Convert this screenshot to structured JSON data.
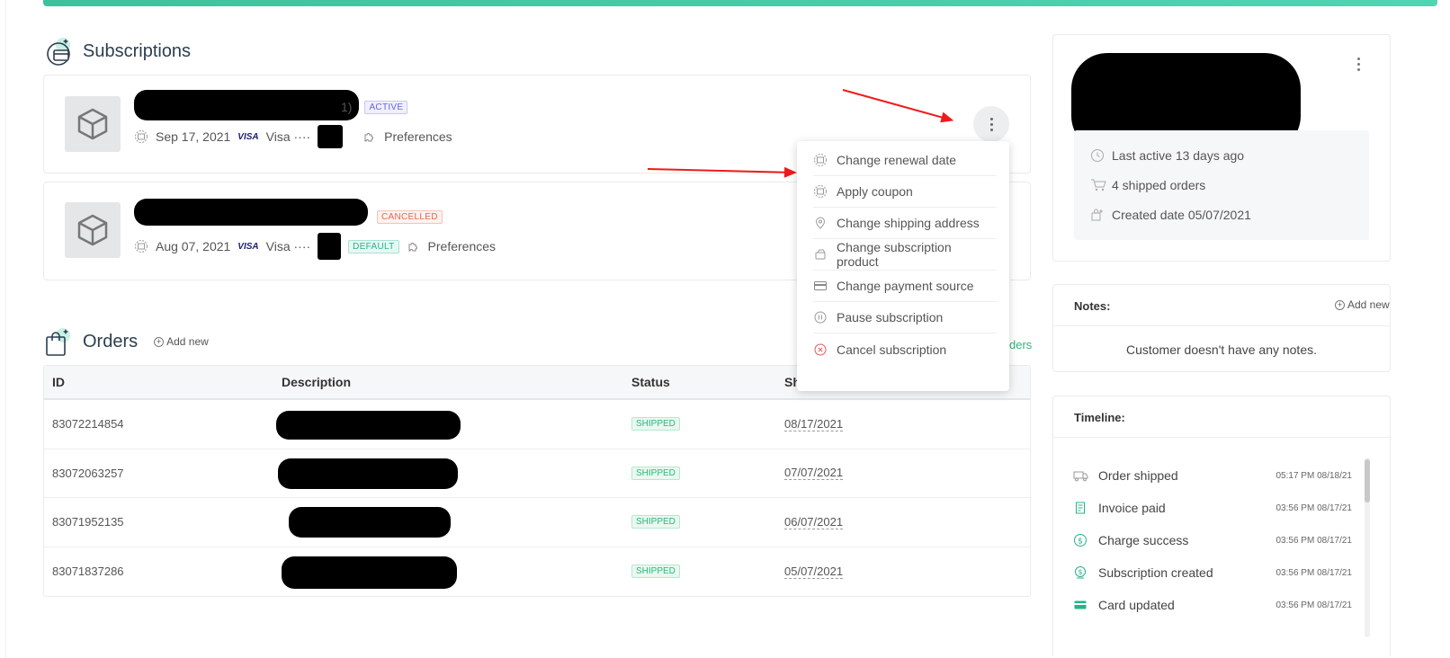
{
  "subscriptions": {
    "title": "Subscriptions",
    "items": [
      {
        "name_suffix": "1)",
        "status": "ACTIVE",
        "date": "Sep 17, 2021",
        "card_brand": "VISA",
        "card_label": "Visa ····",
        "preferences": "Preferences"
      },
      {
        "status": "CANCELLED",
        "date": "Aug 07, 2021",
        "card_brand": "VISA",
        "card_label": "Visa ····",
        "default_badge": "DEFAULT",
        "preferences": "Preferences"
      }
    ]
  },
  "menu": {
    "items": [
      {
        "label": "Change renewal date",
        "icon": "calendar-icon"
      },
      {
        "label": "Apply coupon",
        "icon": "calendar-icon"
      },
      {
        "label": "Change shipping address",
        "icon": "location-pin-icon"
      },
      {
        "label": "Change subscription product",
        "icon": "box-swap-icon"
      },
      {
        "label": "Change payment source",
        "icon": "credit-card-icon"
      },
      {
        "label": "Pause subscription",
        "icon": "pause-circle-icon"
      },
      {
        "label": "Cancel subscription",
        "icon": "cancel-circle-icon"
      }
    ]
  },
  "orders": {
    "title": "Orders",
    "add_new": "Add new",
    "view_all_fragment": "ders",
    "columns": [
      "ID",
      "Description",
      "Status",
      "Sh"
    ],
    "rows": [
      {
        "id": "83072214854",
        "status": "SHIPPED",
        "date": "08/17/2021"
      },
      {
        "id": "83072063257",
        "status": "SHIPPED",
        "date": "07/07/2021"
      },
      {
        "id": "83071952135",
        "status": "SHIPPED",
        "date": "06/07/2021"
      },
      {
        "id": "83071837286",
        "status": "SHIPPED",
        "date": "05/07/2021"
      }
    ]
  },
  "customer": {
    "last_active": "Last active 13 days ago",
    "shipped_orders": "4 shipped orders",
    "created_date": "Created date 05/07/2021"
  },
  "notes": {
    "title": "Notes:",
    "add_new": "Add new",
    "empty_text": "Customer doesn't have any notes."
  },
  "timeline": {
    "title": "Timeline:",
    "items": [
      {
        "label": "Order shipped",
        "time": "05:17 PM 08/18/21",
        "icon": "truck-icon"
      },
      {
        "label": "Invoice paid",
        "time": "03:56 PM 08/17/21",
        "icon": "invoice-icon"
      },
      {
        "label": "Charge success",
        "time": "03:56 PM 08/17/21",
        "icon": "dollar-circle-icon"
      },
      {
        "label": "Subscription created",
        "time": "03:56 PM 08/17/21",
        "icon": "subscription-icon"
      },
      {
        "label": "Card updated",
        "time": "03:56 PM 08/17/21",
        "icon": "card-icon"
      }
    ]
  },
  "colors": {
    "accent": "#3cc39b",
    "arrow": "#ee1b1b"
  }
}
